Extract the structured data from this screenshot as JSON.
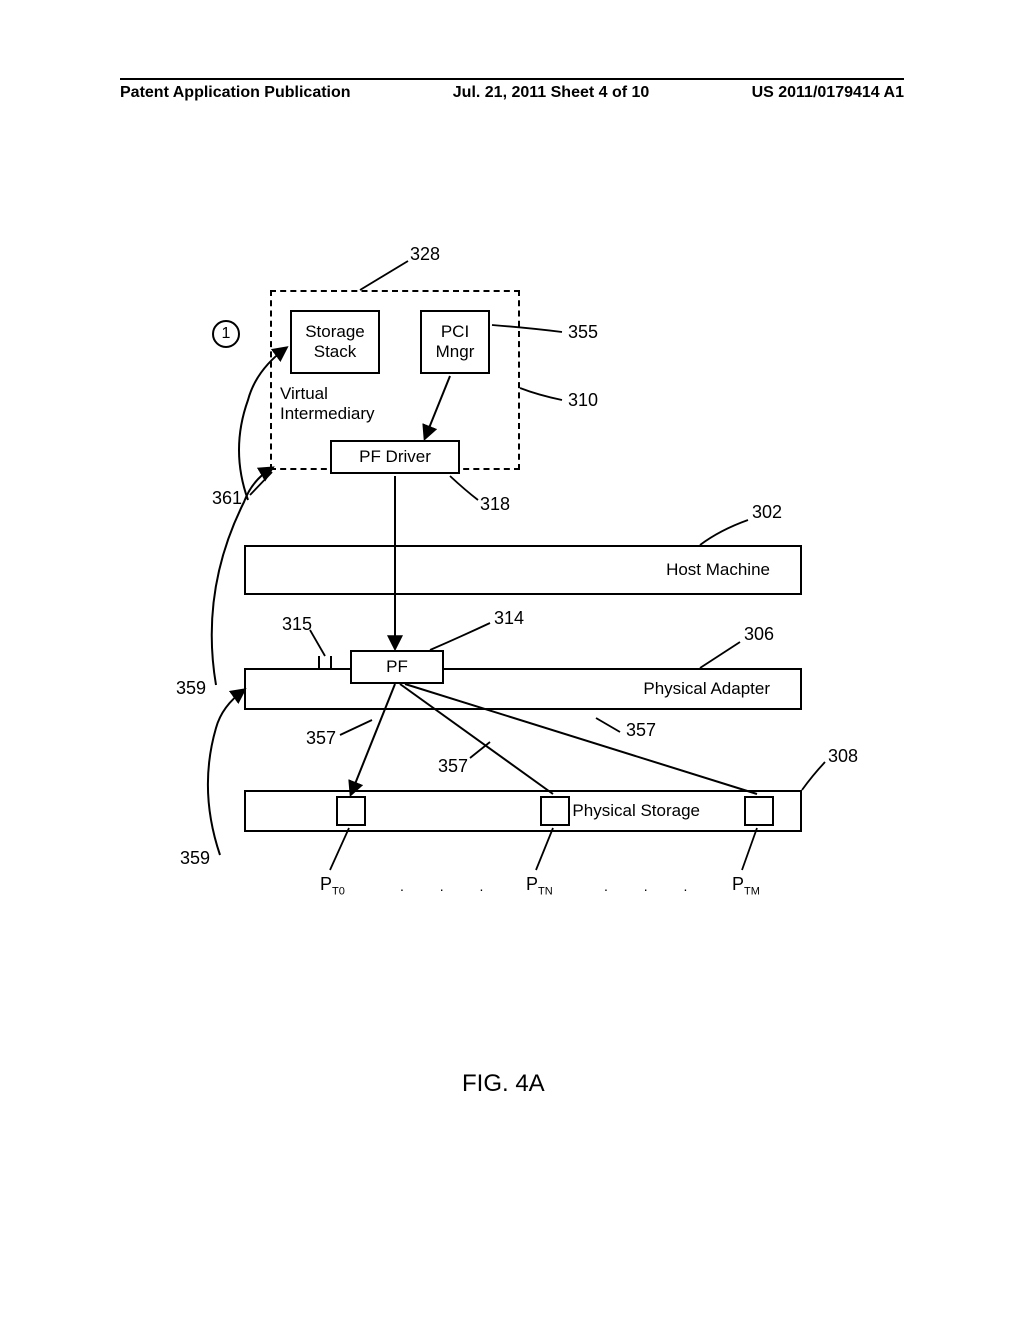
{
  "header": {
    "left": "Patent Application Publication",
    "center": "Jul. 21, 2011   Sheet 4 of 10",
    "right": "US 2011/0179414 A1"
  },
  "diagram": {
    "badge": "1",
    "dashed_group_ref": "328",
    "storage_stack": "Storage Stack",
    "pci_mngr": "PCI Mngr",
    "pci_mngr_ref": "355",
    "virtual_intermediary_line1": "Virtual",
    "virtual_intermediary_line2": "Intermediary",
    "virtual_intermediary_ref": "310",
    "pf_driver": "PF Driver",
    "pf_driver_ref": "318",
    "ref_361": "361",
    "host_machine": "Host Machine",
    "host_machine_ref": "302",
    "pf": "PF",
    "pf_ref_314": "314",
    "pf_ref_315": "315",
    "physical_adapter": "Physical Adapter",
    "physical_adapter_ref": "306",
    "ref_359a": "359",
    "ref_357a": "357",
    "ref_357b": "357",
    "ref_357c": "357",
    "physical_storage": "Physical Storage",
    "physical_storage_ref": "308",
    "ref_359b": "359",
    "pt0_main": "P",
    "pt0_sub": "T0",
    "ptn_main": "P",
    "ptn_sub": "TN",
    "ptm_main": "P",
    "ptm_sub": "TM",
    "ellipsis1": ". . .",
    "ellipsis2": ". . .",
    "figure_label": "FIG. 4A"
  }
}
